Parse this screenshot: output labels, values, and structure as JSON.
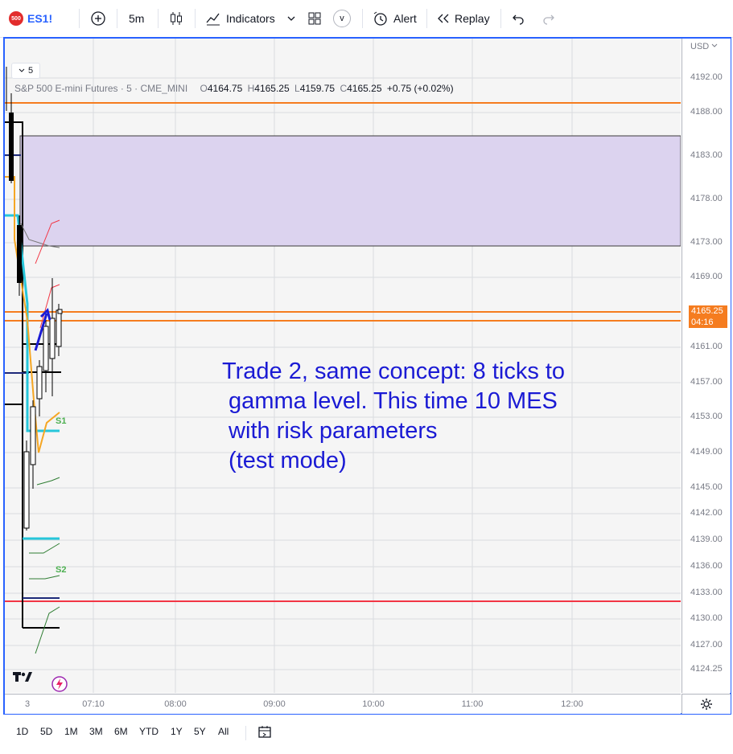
{
  "toolbar": {
    "symbol": "ES1!",
    "logo_text": "500",
    "interval": "5m",
    "indicators_label": "Indicators",
    "alert_label": "Alert",
    "replay_label": "Replay",
    "v_label": "v"
  },
  "legend": {
    "title": "S&P 500 E-mini Futures · 5 · CME_MINI",
    "o_label": "O",
    "o_value": "4164.75",
    "h_label": "H",
    "h_value": "4165.25",
    "l_label": "L",
    "l_value": "4159.75",
    "c_label": "C",
    "c_value": "4165.25",
    "change": "+0.75 (+0.02%)",
    "interval_chip": "5"
  },
  "price_axis": {
    "currency": "USD",
    "labels": [
      "4192.00",
      "4188.00",
      "4183.00",
      "4178.00",
      "4173.00",
      "4169.00",
      "4161.00",
      "4157.00",
      "4153.00",
      "4149.00",
      "4145.00",
      "4142.00",
      "4139.00",
      "4136.00",
      "4133.00",
      "4130.00",
      "4127.00",
      "4124.25"
    ],
    "current_price": "4165.25",
    "countdown": "04:16"
  },
  "time_axis": {
    "labels": [
      "3",
      "07:10",
      "08:00",
      "09:00",
      "10:00",
      "11:00",
      "12:00"
    ]
  },
  "pivot_labels": {
    "s1": "S1",
    "s2": "S2"
  },
  "annotation": {
    "text": "Trade 2, same concept: 8 ticks to\n gamma level. This time 10 MES\n with risk parameters\n (test mode)"
  },
  "ranges": [
    "1D",
    "5D",
    "1M",
    "3M",
    "6M",
    "YTD",
    "1Y",
    "5Y",
    "All"
  ],
  "colors": {
    "accent": "#2962ff",
    "orange_line": "#f57c1f",
    "red_line": "#f23645",
    "zone_fill": "#dcd3ef",
    "annotation_text": "#1a1ad4"
  }
}
